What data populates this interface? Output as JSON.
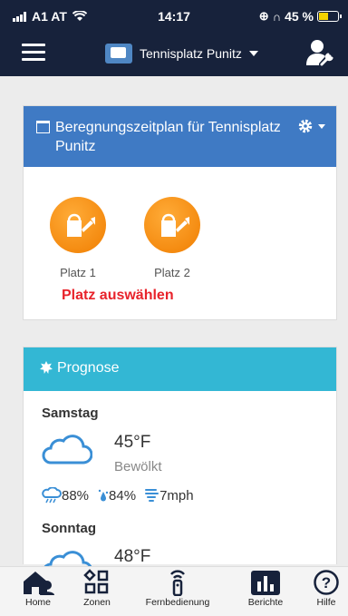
{
  "status_bar": {
    "carrier": "A1 AT",
    "time": "14:17",
    "battery": "45 %",
    "battery_level": 0.45
  },
  "app_bar": {
    "site_name": "Tennisplatz Punitz"
  },
  "schedule_card": {
    "title": "Beregnungszeitplan für Tennisplatz Punitz",
    "zones": [
      {
        "label": "Platz 1"
      },
      {
        "label": "Platz 2"
      }
    ],
    "select_prompt": "Platz auswählen"
  },
  "forecast_card": {
    "title": "Prognose",
    "days": [
      {
        "day": "Samstag",
        "temp": "45°F",
        "condition": "Bewölkt",
        "rain": "88%",
        "humidity": "84%",
        "wind": "7mph"
      },
      {
        "day": "Sonntag",
        "temp": "48°F"
      }
    ]
  },
  "tabs": [
    {
      "label": "Home",
      "icon": "home-icon"
    },
    {
      "label": "Zonen",
      "icon": "zones-icon"
    },
    {
      "label": "Fernbedienung",
      "icon": "remote-icon"
    },
    {
      "label": "Berichte",
      "icon": "reports-icon"
    },
    {
      "label": "Hilfe",
      "icon": "help-icon"
    }
  ],
  "colors": {
    "app_bar": "#17223b",
    "schedule_header": "#3f7ac4",
    "forecast_header": "#33b7d4",
    "zone": "#f58a0b",
    "prompt": "#e8232b"
  }
}
